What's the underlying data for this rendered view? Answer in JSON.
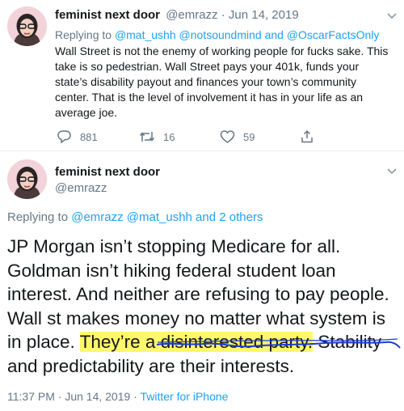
{
  "tweet1": {
    "display_name": "feminist next door",
    "handle_date": "@emrazz · Jun 14, 2019",
    "replying_prefix": "Replying to",
    "replying_to": "@mat_ushh @notsoundmind and @OscarFactsOnly",
    "text": "Wall Street is not the enemy of working people for fucks sake. This take is so pedestrian. Wall Street pays your 401k, funds your state’s disability payout and finances your town’s community center. That is the level of involvement it has in your life as an average joe.",
    "actions": {
      "reply_icon": "reply-icon",
      "reply_count": "881",
      "retweet_icon": "retweet-icon",
      "retweet_count": "16",
      "like_icon": "heart-icon",
      "like_count": "59",
      "share_icon": "share-icon"
    },
    "menu_icon": "chevron-down-icon"
  },
  "tweet2": {
    "display_name": "feminist next door",
    "handle": "@emrazz",
    "menu_icon": "chevron-down-icon",
    "replying_prefix": "Replying to",
    "replying_to": "@emrazz @mat_ushh and 2 others",
    "text_before": "JP Morgan isn’t stopping Medicare for all. Goldman isn’t hiking federal student loan interest. And neither are refusing to pay people. Wall st makes money no matter what system is in place. ",
    "text_highlight": "They’re a disinterested party.",
    "text_after": " Stability and predictability are their interests.",
    "time": "11:37 PM · Jun 14, 2019 · ",
    "source": "Twitter for iPhone",
    "highlight_color": "#fff86b",
    "underline_color": "#1a3bd6"
  },
  "colors": {
    "link": "#1da1f2",
    "muted": "#657786",
    "text": "#14171a"
  }
}
